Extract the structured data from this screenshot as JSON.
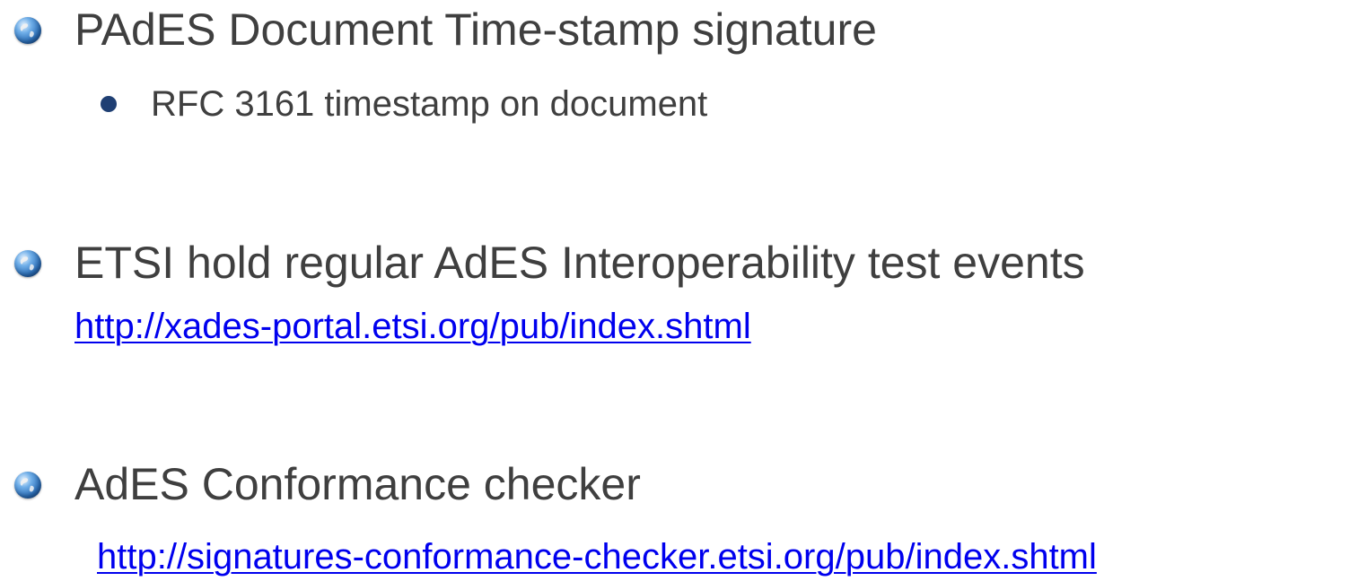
{
  "bullets": [
    {
      "heading": "PAdES Document Time-stamp signature",
      "sub_items": [
        "RFC 3161 timestamp on document"
      ]
    },
    {
      "heading": "ETSI hold regular AdES Interoperability test events",
      "link": "http://xades-portal.etsi.org/pub/index.shtml"
    },
    {
      "heading": "AdES Conformance checker",
      "link": "http://signatures-conformance-checker.etsi.org/pub/index.shtml"
    }
  ],
  "colors": {
    "text": "#3f3f3f",
    "link": "#0000ee",
    "sub_bullet": "#1f3f73"
  },
  "icons": {
    "bullet": "globe-icon",
    "sub_bullet": "dot-icon"
  }
}
